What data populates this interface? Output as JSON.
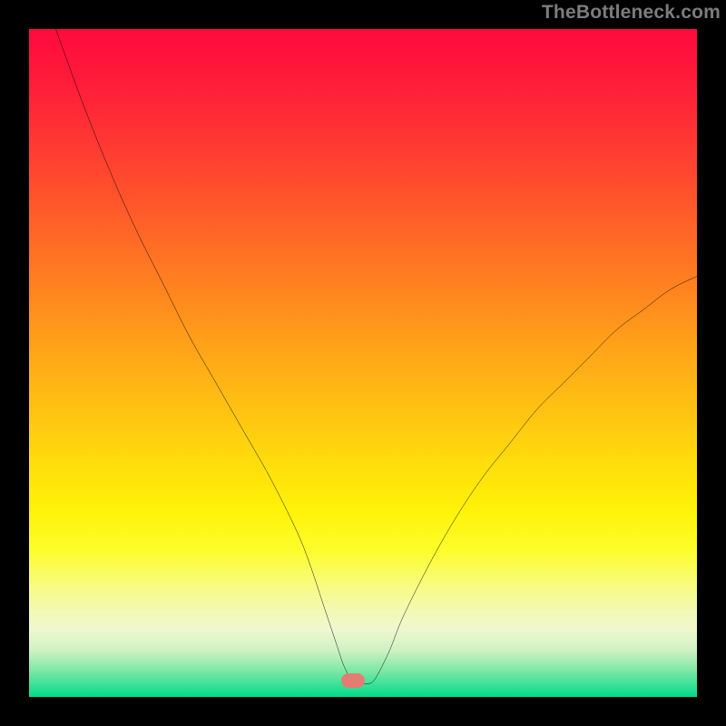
{
  "source_label": "TheBottleneck.com",
  "marker": {
    "x_frac": 0.485,
    "y_frac": 0.975,
    "w": 26,
    "h": 16
  },
  "chart_data": {
    "type": "line",
    "title": "",
    "xlabel": "",
    "ylabel": "",
    "xlim": [
      0,
      100
    ],
    "ylim": [
      0,
      100
    ],
    "grid": false,
    "legend": false,
    "series": [
      {
        "name": "bottleneck-curve",
        "x": [
          4,
          8,
          12,
          16,
          20,
          24,
          28,
          32,
          36,
          40,
          42,
          44,
          46,
          47,
          48,
          49,
          50,
          51,
          52,
          54,
          56,
          60,
          64,
          68,
          72,
          76,
          80,
          84,
          88,
          92,
          96,
          100
        ],
        "y": [
          100,
          89,
          79,
          70,
          62,
          54,
          47,
          40,
          33,
          25,
          20,
          14,
          8,
          5,
          3,
          2,
          2,
          2,
          3,
          7,
          12,
          20,
          27,
          33,
          38,
          43,
          47,
          51,
          55,
          58,
          61,
          63
        ]
      }
    ],
    "annotations": [
      {
        "type": "marker",
        "x": 48.5,
        "y": 2.5,
        "label": "optimal-point"
      }
    ]
  }
}
